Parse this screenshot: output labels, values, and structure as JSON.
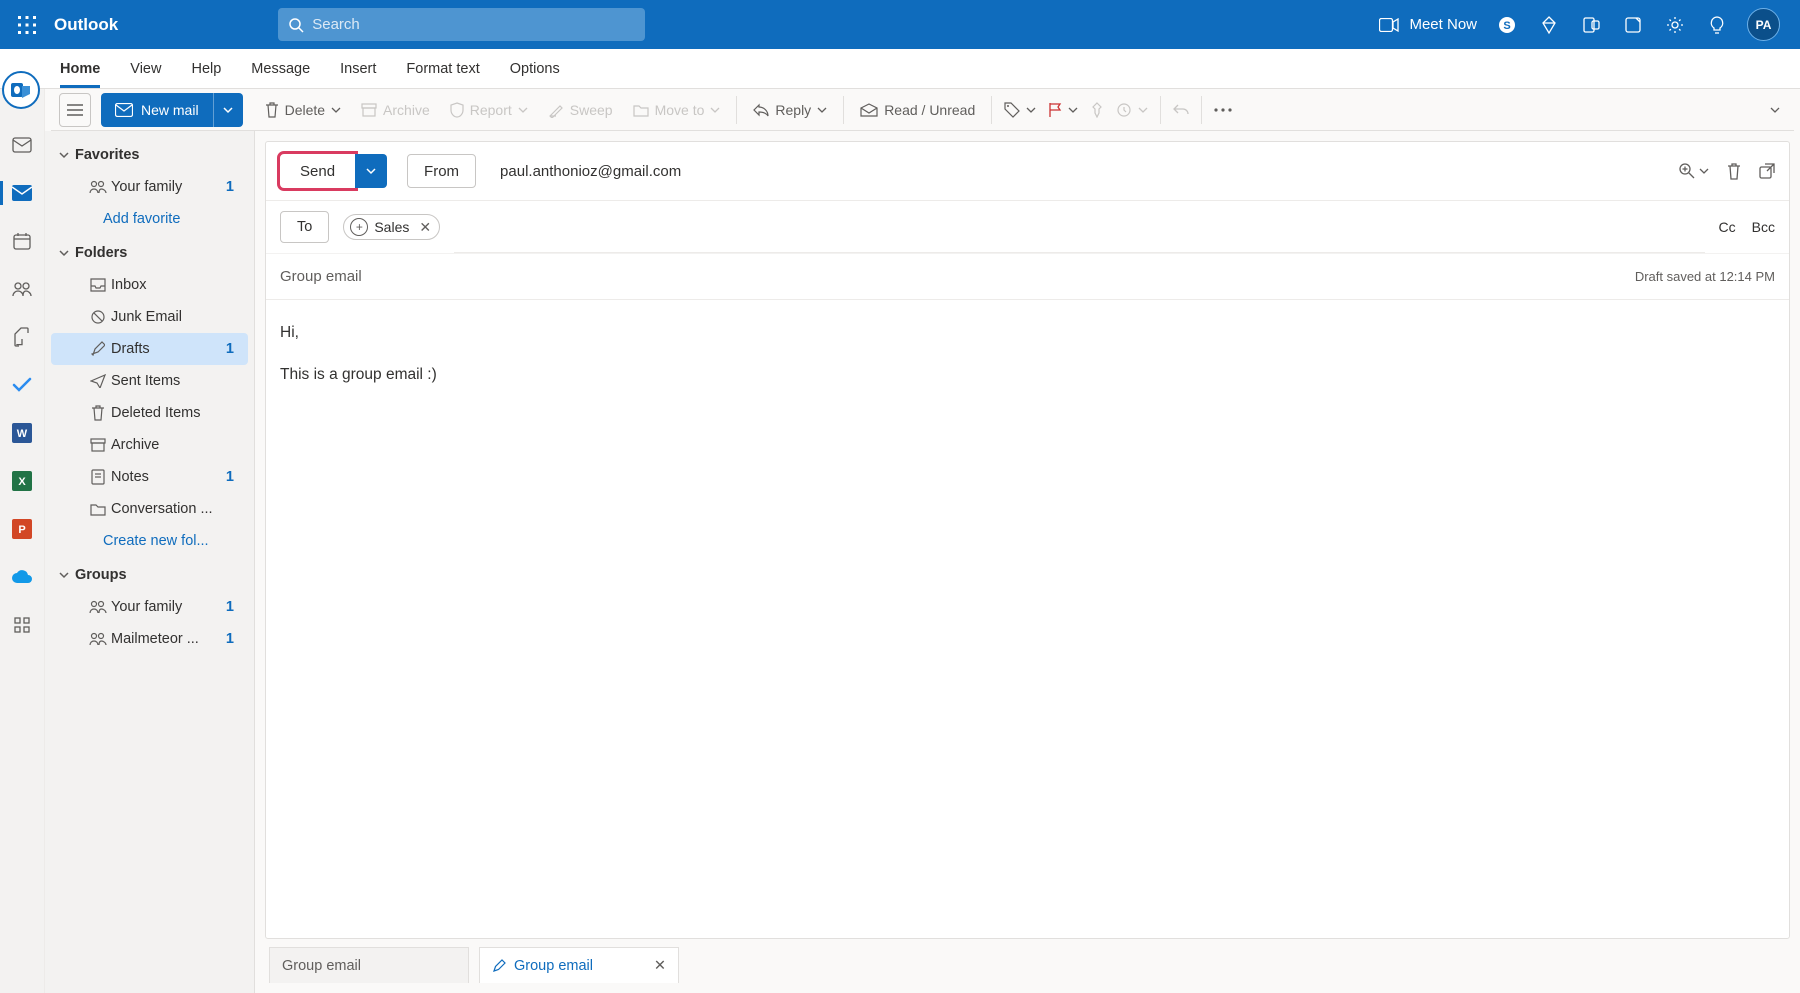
{
  "header": {
    "brand": "Outlook",
    "search_placeholder": "Search",
    "meet_now": "Meet Now",
    "avatar_initials": "PA"
  },
  "tabs": {
    "items": [
      "Home",
      "View",
      "Help",
      "Message",
      "Insert",
      "Format text",
      "Options"
    ],
    "active_index": 0
  },
  "toolbar": {
    "new_mail": "New mail",
    "delete": "Delete",
    "archive": "Archive",
    "report": "Report",
    "sweep": "Sweep",
    "move_to": "Move to",
    "reply": "Reply",
    "read_unread": "Read / Unread"
  },
  "folders": {
    "favorites_label": "Favorites",
    "favorites": [
      {
        "label": "Your family",
        "count": "1"
      }
    ],
    "add_favorite": "Add favorite",
    "folders_label": "Folders",
    "items": [
      {
        "label": "Inbox",
        "icon": "inbox",
        "count": ""
      },
      {
        "label": "Junk Email",
        "icon": "junk",
        "count": ""
      },
      {
        "label": "Drafts",
        "icon": "drafts",
        "count": "1",
        "selected": true
      },
      {
        "label": "Sent Items",
        "icon": "sent",
        "count": ""
      },
      {
        "label": "Deleted Items",
        "icon": "trash",
        "count": ""
      },
      {
        "label": "Archive",
        "icon": "archive",
        "count": ""
      },
      {
        "label": "Notes",
        "icon": "notes",
        "count": "1"
      },
      {
        "label": "Conversation ...",
        "icon": "folder",
        "count": ""
      }
    ],
    "create_new_folder": "Create new fol...",
    "groups_label": "Groups",
    "groups": [
      {
        "label": "Your family",
        "count": "1"
      },
      {
        "label": "Mailmeteor ...",
        "count": "1"
      }
    ]
  },
  "compose": {
    "send": "Send",
    "from_label": "From",
    "from_email": "paul.anthonioz@gmail.com",
    "to_label": "To",
    "to_chip": "Sales",
    "cc": "Cc",
    "bcc": "Bcc",
    "subject": "Group email",
    "draft_saved": "Draft saved at 12:14 PM",
    "body_line1": "Hi,",
    "body_line2": "This is a group email :)"
  },
  "bottom_tabs": [
    {
      "label": "Group email",
      "active": false,
      "closable": false
    },
    {
      "label": "Group email",
      "active": true,
      "closable": true
    }
  ]
}
